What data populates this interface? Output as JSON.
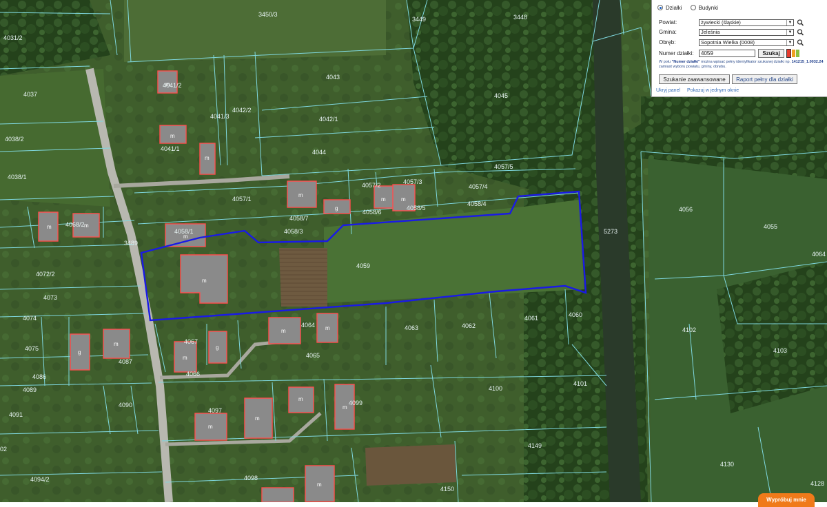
{
  "panel": {
    "radio_parcels": "Działki",
    "radio_buildings": "Budynki",
    "powiat_label": "Powiat:",
    "powiat_value": "żywiecki (śląskie)",
    "gmina_label": "Gmina:",
    "gmina_value": "Jeleśnia",
    "obreb_label": "Obręb:",
    "obreb_value": "Sopotnia Wielka (0008)",
    "number_label": "Numer działki:",
    "number_value": "4059",
    "search_button": "Szukaj",
    "help_prefix": "W polu ",
    "help_field": "\"Numer działki\"",
    "help_mid": " można wpisać pełny identyfikator szukanej działki np. ",
    "help_example": "141215_1.0032.24",
    "help_suffix": " zamiast wyboru powiatu, gminy, obrębu.",
    "advanced_button": "Szukanie zaawansowane",
    "report_button": "Raport pełny dla działki",
    "hide_link": "Ukryj panel",
    "window_link": "Pokazuj w jednym oknie",
    "colors": [
      "#e63b2e",
      "#f0a020",
      "#8cc040"
    ]
  },
  "try_button": "Wypróbuj mnie",
  "map": {
    "parcel_labels": [
      "3450/3",
      "3449",
      "3448",
      "4031/2",
      "4037",
      "4041/2",
      "4043",
      "4045",
      "4041/3",
      "4042/2",
      "4042/1",
      "4038/2",
      "4041/1",
      "4044",
      "4038/1",
      "4057/5",
      "4057/2",
      "4057/3",
      "4057/4",
      "4057/1",
      "4058/6",
      "4058/4",
      "4068/2",
      "4058/1",
      "4058/7",
      "4058/3",
      "4058/5",
      "3489",
      "4059",
      "5273",
      "4056",
      "4055",
      "4064",
      "4072/2",
      "4073",
      "4074",
      "4064",
      "4063",
      "4062",
      "4061",
      "4060",
      "4102",
      "4103",
      "4075",
      "4067",
      "4065",
      "4087",
      "4086",
      "4066",
      "4089",
      "4100",
      "4101",
      "4090",
      "4091",
      "4097",
      "4099",
      "4149",
      "4130",
      "4094/2",
      "4098",
      "4150",
      "4128",
      "02"
    ],
    "building_marks": [
      "m",
      "m",
      "m",
      "m",
      "m",
      "m",
      "m",
      "m",
      "m",
      "m",
      "m",
      "m",
      "m",
      "m",
      "m",
      "m",
      "g",
      "g",
      "g",
      "m",
      "m",
      "m"
    ]
  }
}
